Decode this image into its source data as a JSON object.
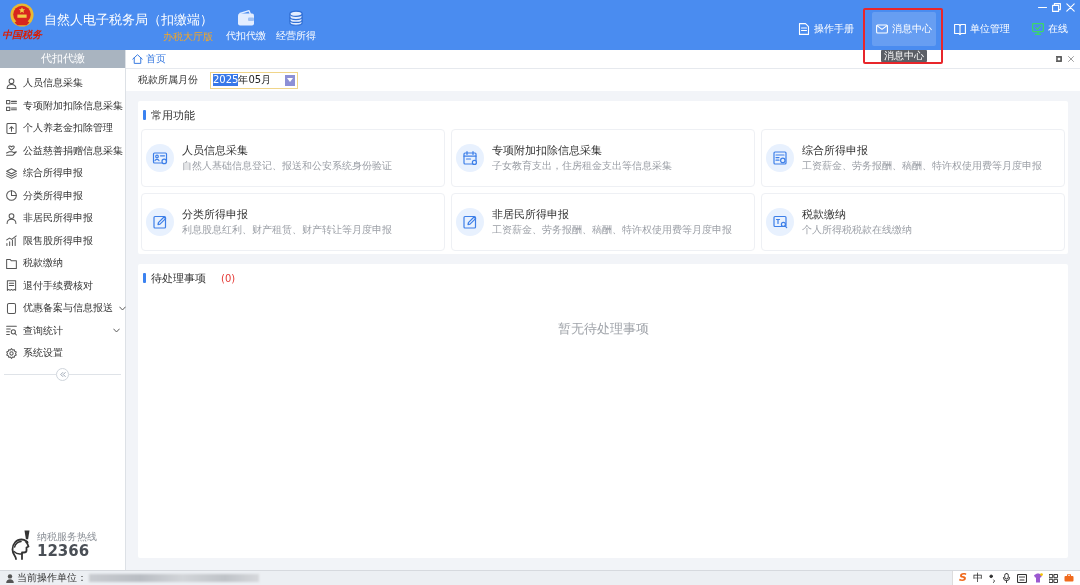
{
  "header": {
    "logo_text": "中国税务",
    "title": "自然人电子税务局（扣缴端）",
    "edition": "办税大厅版",
    "nav": [
      {
        "label": "代扣代缴"
      },
      {
        "label": "经营所得"
      }
    ],
    "tools": [
      {
        "label": "操作手册",
        "hovered": false,
        "annotated": false
      },
      {
        "label": "消息中心",
        "hovered": true,
        "annotated": true,
        "tooltip": "消息中心"
      },
      {
        "label": "单位管理",
        "hovered": false,
        "annotated": false
      },
      {
        "label": "在线",
        "hovered": false,
        "annotated": false
      }
    ]
  },
  "sidebar": {
    "title": "代扣代缴",
    "items": [
      {
        "label": "人员信息采集",
        "kind": "item"
      },
      {
        "label": "专项附加扣除信息采集",
        "kind": "item"
      },
      {
        "label": "个人养老金扣除管理",
        "kind": "item"
      },
      {
        "label": "公益慈善捐赠信息采集",
        "kind": "item"
      },
      {
        "label": "综合所得申报",
        "kind": "item"
      },
      {
        "label": "分类所得申报",
        "kind": "item"
      },
      {
        "label": "非居民所得申报",
        "kind": "item"
      },
      {
        "label": "限售股所得申报",
        "kind": "item"
      },
      {
        "label": "税款缴纳",
        "kind": "item"
      },
      {
        "label": "退付手续费核对",
        "kind": "item"
      },
      {
        "label": "优惠备案与信息报送",
        "kind": "group"
      },
      {
        "label": "查询统计",
        "kind": "group"
      },
      {
        "label": "系统设置",
        "kind": "item"
      }
    ],
    "hotline": {
      "label": "纳税服务热线",
      "number": "12366"
    }
  },
  "main": {
    "tabs": [
      {
        "label": "首页",
        "selected": true
      }
    ],
    "filter": {
      "label": "税款所属月份",
      "value_parts": [
        {
          "text": "2025",
          "selected": true
        },
        {
          "text": "年05月",
          "selected": false
        }
      ]
    },
    "common": {
      "title": "常用功能",
      "tiles": [
        {
          "title": "人员信息采集",
          "desc": "自然人基础信息登记、报送和公安系统身份验证"
        },
        {
          "title": "专项附加扣除信息采集",
          "desc": "子女教育支出，住房租金支出等信息采集"
        },
        {
          "title": "综合所得申报",
          "desc": "工资薪金、劳务报酬、稿酬、特许权使用费等月度申报"
        },
        {
          "title": "分类所得申报",
          "desc": "利息股息红利、财产租赁、财产转让等月度申报"
        },
        {
          "title": "非居民所得申报",
          "desc": "工资薪金、劳务报酬、稿酬、特许权使用费等月度申报"
        },
        {
          "title": "税款缴纳",
          "desc": "个人所得税税款在线缴纳"
        }
      ]
    },
    "pending": {
      "title": "待处理事项",
      "count": "(0)",
      "empty_text": "暂无待处理事项"
    }
  },
  "status_bar": {
    "label": "当前操作单位：",
    "ime": {
      "logo": "S",
      "mode": "中"
    }
  }
}
